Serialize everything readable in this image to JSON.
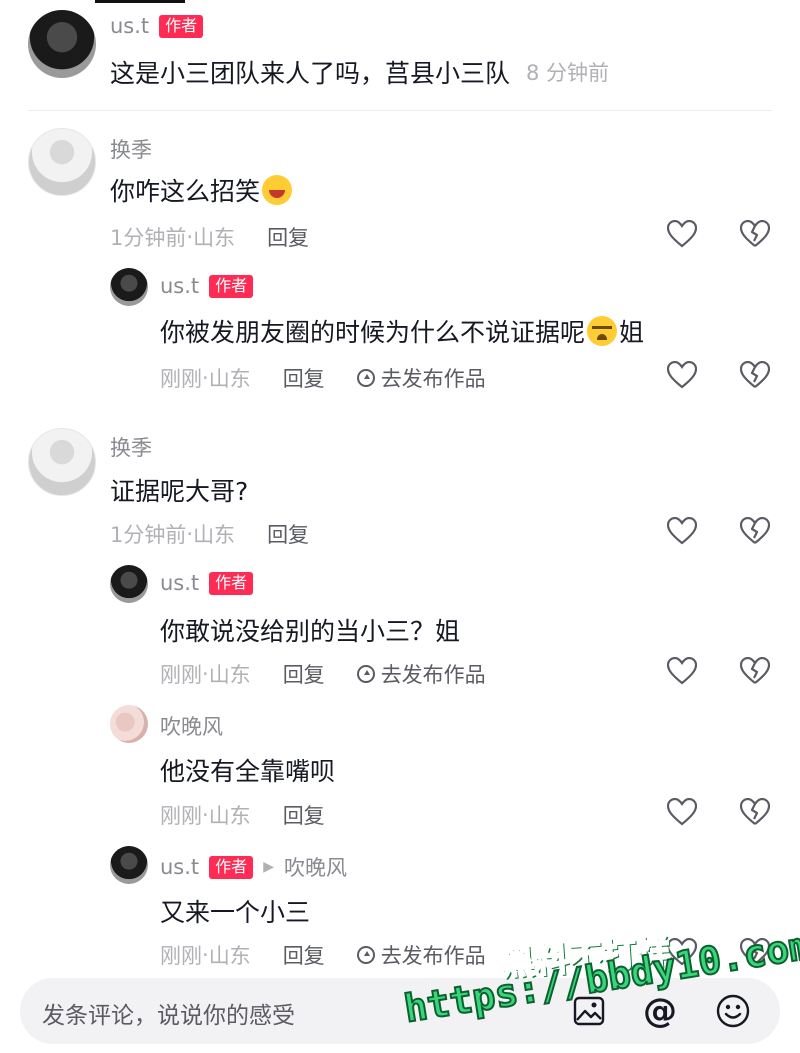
{
  "comments": [
    {
      "username": "us.t",
      "badge": "作者",
      "text": "这是小三团队来人了吗，莒县小三队",
      "time": "8 分钟前"
    },
    {
      "username": "换季",
      "text": "你咋这么招笑",
      "emoji": "laugh-cry-emoji",
      "time": "1分钟前",
      "location": "山东",
      "reply_label": "回复"
    },
    {
      "username": "us.t",
      "badge": "作者",
      "text": "你被发朋友圈的时候为什么不说证据呢",
      "text_after_emoji": "姐",
      "emoji": "crying-emoji",
      "time": "刚刚",
      "location": "山东",
      "reply_label": "回复",
      "publish_label": "去发布作品"
    },
    {
      "username": "换季",
      "text": "证据呢大哥?",
      "time": "1分钟前",
      "location": "山东",
      "reply_label": "回复"
    },
    {
      "username": "us.t",
      "badge": "作者",
      "text": "你敢说没给别的当小三？姐",
      "time": "刚刚",
      "location": "山东",
      "reply_label": "回复",
      "publish_label": "去发布作品"
    },
    {
      "username": "吹晚风",
      "text": "他没有全靠嘴呗",
      "time": "刚刚",
      "location": "山东",
      "reply_label": "回复"
    },
    {
      "username": "us.t",
      "badge": "作者",
      "reply_to": "吹晚风",
      "text": "又来一个小三",
      "time": "刚刚",
      "location": "山东",
      "reply_label": "回复",
      "publish_label": "去发布作品"
    }
  ],
  "meta_separator": " · ",
  "input": {
    "placeholder": "发条评论，说说你的感受",
    "at_symbol": "@"
  },
  "watermark": {
    "line1": "黑料不打烊",
    "line2": "https://bbdy10.com"
  },
  "colors": {
    "badge": "#fe2c55",
    "muted_text": "#b0b1b5",
    "username": "#8a8b91"
  }
}
